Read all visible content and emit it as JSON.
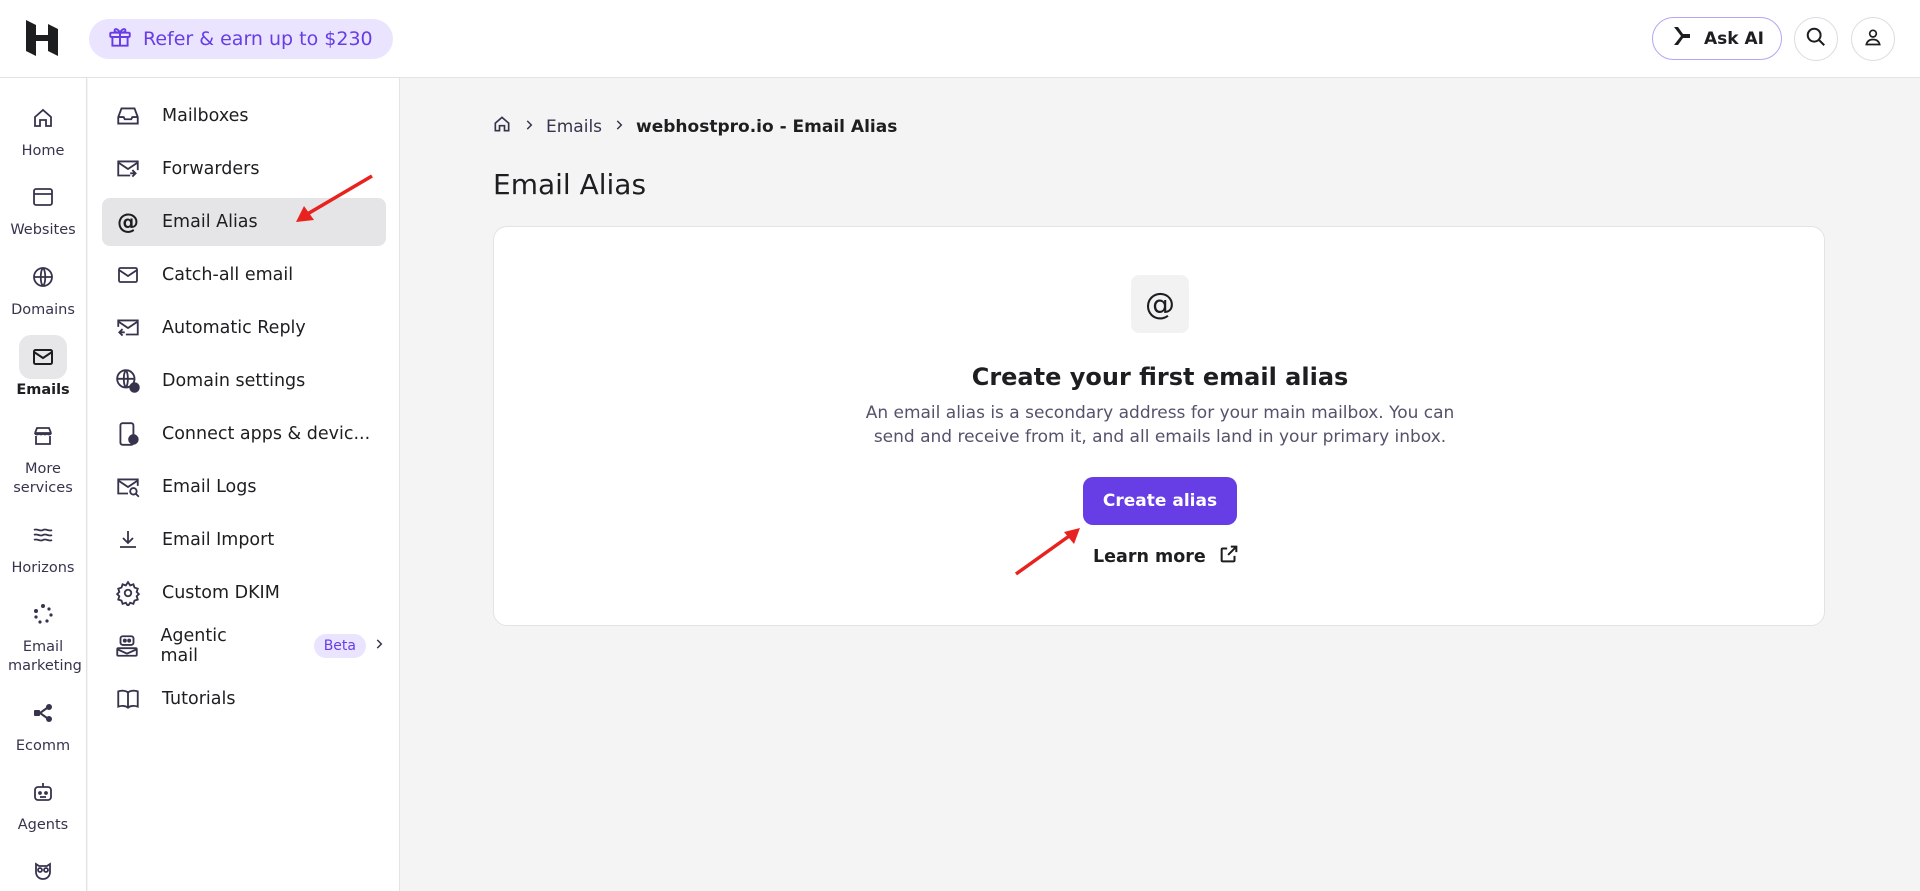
{
  "header": {
    "refer_label": "Refer & earn up to $230",
    "ask_ai_label": "Ask AI",
    "brand_color": "#673de6"
  },
  "rail": {
    "items": [
      {
        "label": "Home",
        "icon": "home-icon"
      },
      {
        "label": "Websites",
        "icon": "browser-icon"
      },
      {
        "label": "Domains",
        "icon": "globe-icon"
      },
      {
        "label": "Emails",
        "icon": "mail-icon",
        "active": true
      },
      {
        "label": "More services",
        "icon": "store-icon"
      },
      {
        "label": "Horizons",
        "icon": "waves-icon"
      },
      {
        "label": "Email marketing",
        "icon": "sparkle-icon"
      },
      {
        "label": "Ecomm",
        "icon": "nodes-icon"
      },
      {
        "label": "Agents",
        "icon": "robot-icon"
      },
      {
        "label": "",
        "icon": "owl-icon"
      }
    ]
  },
  "subnav": {
    "items": [
      {
        "label": "Mailboxes",
        "icon": "inbox-icon"
      },
      {
        "label": "Forwarders",
        "icon": "mail-forward-icon"
      },
      {
        "label": "Email Alias",
        "icon": "at-icon",
        "active": true
      },
      {
        "label": "Catch-all email",
        "icon": "envelope-icon"
      },
      {
        "label": "Automatic Reply",
        "icon": "mail-reply-icon"
      },
      {
        "label": "Domain settings",
        "icon": "globe-settings-icon"
      },
      {
        "label": "Connect apps & devic...",
        "icon": "device-add-icon"
      },
      {
        "label": "Email Logs",
        "icon": "mail-search-icon"
      },
      {
        "label": "Email Import",
        "icon": "download-icon"
      },
      {
        "label": "Custom DKIM",
        "icon": "gear-icon"
      },
      {
        "label": "Agentic mail",
        "icon": "agent-mail-icon",
        "badge": "Beta"
      },
      {
        "label": "Tutorials",
        "icon": "book-icon"
      }
    ]
  },
  "breadcrumb": {
    "parent": "Emails",
    "current": "webhostpro.io - Email Alias"
  },
  "main": {
    "title": "Email Alias",
    "empty_icon": "@",
    "empty_title": "Create your first email alias",
    "empty_desc": "An email alias is a secondary address for your main mailbox. You can send and receive from it, and all emails land in your primary inbox.",
    "create_label": "Create alias",
    "learn_label": "Learn more"
  }
}
